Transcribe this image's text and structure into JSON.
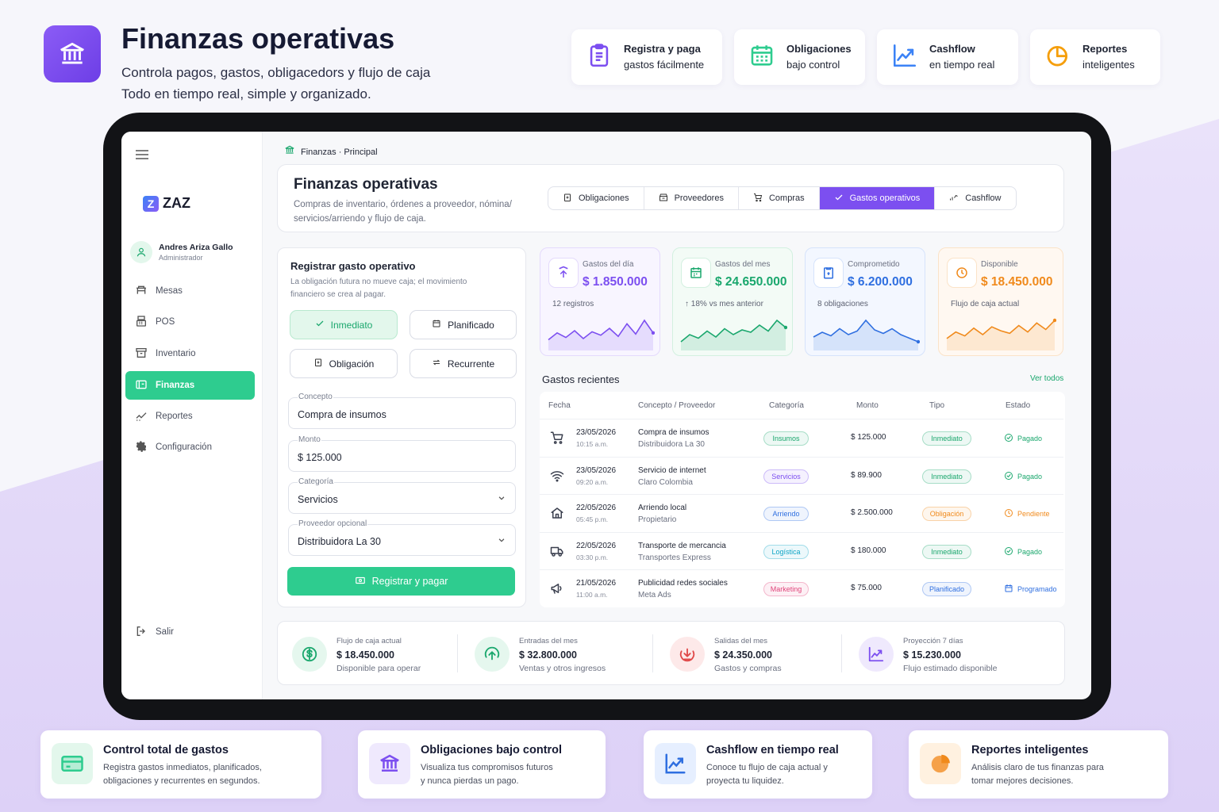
{
  "hero": {
    "title": "Finanzas operativas",
    "subtitle_line1": "Controla pagos, gastos, obligacedors y flujo de caja",
    "subtitle_line2": "Todo en tiempo real, simple y organizado.",
    "logo_icon": "bank-icon",
    "features": [
      {
        "line1": "Registra y paga",
        "line2": "gastos fácilmente",
        "icon": "clipboard-icon",
        "color": "#7c4ff0"
      },
      {
        "line1": "Obligaciones",
        "line2": "bajo control",
        "icon": "calendar-icon",
        "color": "#2ecc8f"
      },
      {
        "line1": "Cashflow",
        "line2": "en tiempo real",
        "icon": "trend-chart-icon",
        "color": "#3b82f6"
      },
      {
        "line1": "Reportes",
        "line2": "inteligentes",
        "icon": "pie-chart-icon",
        "color": "#f59e0b"
      }
    ]
  },
  "app": {
    "brand": "ZAZ",
    "user": {
      "name": "Andres Ariza Gallo",
      "role": "Administrador"
    },
    "nav": [
      {
        "label": "Mesas",
        "icon": "table-icon"
      },
      {
        "label": "POS",
        "icon": "register-icon"
      },
      {
        "label": "Inventario",
        "icon": "box-icon"
      },
      {
        "label": "Finanzas",
        "icon": "wallet-icon",
        "active": true
      },
      {
        "label": "Reportes",
        "icon": "trend-icon"
      },
      {
        "label": "Configuración",
        "icon": "gear-icon"
      }
    ],
    "logout": "Salir",
    "breadcrumb": "Finanzas · Principal",
    "page_title": "Finanzas operativas",
    "page_desc_line1": "Compras de inventario, órdenes a proveedor, nómina/",
    "page_desc_line2": "servicios/arriendo y flujo de caja.",
    "tabs": [
      {
        "label": "Obligaciones",
        "icon": "clipboard-icon"
      },
      {
        "label": "Proveedores",
        "icon": "store-icon"
      },
      {
        "label": "Compras",
        "icon": "cart-icon"
      },
      {
        "label": "Gastos operativos",
        "icon": "check-icon",
        "active": true
      },
      {
        "label": "Cashflow",
        "icon": "cashflow-icon"
      }
    ]
  },
  "form": {
    "title": "Registrar gasto operativo",
    "desc_line1": "La obligación futura no mueve caja; el movimiento",
    "desc_line2": "financiero se crea al pagar.",
    "options": [
      "Inmediato",
      "Planificado",
      "Obligación",
      "Recurrente"
    ],
    "selected_option": "Inmediato",
    "concepto_label": "Concepto",
    "concepto_value": "Compra de insumos",
    "monto_label": "Monto",
    "monto_value": "$ 125.000",
    "categoria_label": "Categoría",
    "categoria_value": "Servicios",
    "proveedor_label": "Proveedor opcional",
    "proveedor_value": "Distribuidora La 30",
    "submit": "Registrar y pagar"
  },
  "kpis": [
    {
      "label": "Gastos del día",
      "value": "$ 1.850.000",
      "sub": "12 registros",
      "color": "#7c4ff0",
      "bg": "#f8f5ff",
      "border": "#e4dafc",
      "icon": "upload-icon",
      "spark": [
        8,
        14,
        10,
        16,
        9,
        15,
        12,
        18,
        11,
        22,
        13,
        25,
        14
      ]
    },
    {
      "label": "Gastos del mes",
      "value": "$ 24.650.000",
      "sub": "↑ 18% vs mes anterior",
      "color": "#1aa76d",
      "bg": "#f3fbf6",
      "border": "#d3f0e0",
      "icon": "calendar-icon",
      "spark": [
        6,
        12,
        9,
        15,
        10,
        17,
        12,
        16,
        14,
        20,
        15,
        24,
        18
      ]
    },
    {
      "label": "Comprometido",
      "value": "$ 6.200.000",
      "sub": "8 obligaciones",
      "color": "#2f6fe0",
      "bg": "#f3f7ff",
      "border": "#d6e3fb",
      "icon": "document-icon",
      "spark": [
        10,
        14,
        11,
        17,
        12,
        15,
        24,
        16,
        13,
        17,
        12,
        9,
        6
      ]
    },
    {
      "label": "Disponible",
      "value": "$ 18.450.000",
      "sub": "Flujo de caja actual",
      "color": "#f08a1c",
      "bg": "#fff8f1",
      "border": "#fbe3c8",
      "icon": "clock-icon",
      "spark": [
        8,
        13,
        10,
        16,
        11,
        17,
        14,
        12,
        18,
        13,
        20,
        15,
        22
      ]
    }
  ],
  "recent": {
    "title": "Gastos recientes",
    "see_all": "Ver todos",
    "headers": [
      "Fecha",
      "Concepto / Proveedor",
      "Categoría",
      "Monto",
      "Tipo",
      "Estado"
    ],
    "rows": [
      {
        "icon": "cart-icon",
        "date": "23/05/2026",
        "time": "10:15 a.m.",
        "concept": "Compra de insumos",
        "provider": "Distribuidora La 30",
        "category": "Insumos",
        "cat_color": "#1aa76d",
        "amount": "$ 125.000",
        "type": "Inmediato",
        "type_color": "#1aa76d",
        "status": "Pagado",
        "status_color": "#1aa76d",
        "status_icon": "check-circle-icon"
      },
      {
        "icon": "wifi-icon",
        "date": "23/05/2026",
        "time": "09:20 a.m.",
        "concept": "Servicio de internet",
        "provider": "Claro Colombia",
        "category": "Servicios",
        "cat_color": "#7c4ff0",
        "amount": "$ 89.900",
        "type": "Inmediato",
        "type_color": "#1aa76d",
        "status": "Pagado",
        "status_color": "#1aa76d",
        "status_icon": "check-circle-icon"
      },
      {
        "icon": "home-icon",
        "date": "22/05/2026",
        "time": "05:45 p.m.",
        "concept": "Arriendo local",
        "provider": "Propietario",
        "category": "Arriendo",
        "cat_color": "#2f6fe0",
        "amount": "$ 2.500.000",
        "type": "Obligación",
        "type_color": "#f08a1c",
        "status": "Pendiente",
        "status_color": "#f08a1c",
        "status_icon": "clock-icon"
      },
      {
        "icon": "truck-icon",
        "date": "22/05/2026",
        "time": "03:30 p.m.",
        "concept": "Transporte de mercancia",
        "provider": "Transportes Express",
        "category": "Logística",
        "cat_color": "#0ea5c6",
        "amount": "$ 180.000",
        "type": "Inmediato",
        "type_color": "#1aa76d",
        "status": "Pagado",
        "status_color": "#1aa76d",
        "status_icon": "check-circle-icon"
      },
      {
        "icon": "megaphone-icon",
        "date": "21/05/2026",
        "time": "11:00 a.m.",
        "concept": "Publicidad redes sociales",
        "provider": "Meta Ads",
        "category": "Marketing",
        "cat_color": "#e0457b",
        "amount": "$ 75.000",
        "type": "Planificado",
        "type_color": "#2f6fe0",
        "status": "Programado",
        "status_color": "#2f6fe0",
        "status_icon": "calendar-icon"
      }
    ]
  },
  "cashflow": [
    {
      "label": "Flujo de caja actual",
      "value": "$ 18.450.000",
      "sub": "Disponible para operar",
      "icon": "dollar-icon",
      "color": "#1aa76d",
      "bg": "#e5f7ee"
    },
    {
      "label": "Entradas del mes",
      "value": "$ 32.800.000",
      "sub": "Ventas y otros ingresos",
      "icon": "arrow-up-circle-icon",
      "color": "#1aa76d",
      "bg": "#e5f7ee"
    },
    {
      "label": "Salidas del mes",
      "value": "$ 24.350.000",
      "sub": "Gastos y compras",
      "icon": "arrow-down-circle-icon",
      "color": "#e04848",
      "bg": "#fde9e9"
    },
    {
      "label": "Proyección 7 días",
      "value": "$ 15.230.000",
      "sub": "Flujo estimado disponible",
      "icon": "trend-chart-icon",
      "color": "#7c4ff0",
      "bg": "#efe9fd"
    }
  ],
  "bottom_features": [
    {
      "title": "Control total de gastos",
      "line1": "Registra gastos inmediatos, planificados,",
      "line2": "obligaciones y recurrentes en segundos.",
      "icon": "card-icon",
      "color": "#2ecc8f",
      "bg": "#e3f7ec"
    },
    {
      "title": "Obligaciones bajo control",
      "line1": "Visualiza tus compromisos futuros",
      "line2": "y nunca pierdas un pago.",
      "icon": "bank-icon",
      "color": "#7c4ff0",
      "bg": "#efe9fd"
    },
    {
      "title": "Cashflow en tiempo real",
      "line1": "Conoce tu flujo de caja actual y",
      "line2": "proyecta tu liquidez.",
      "icon": "trend-chart-icon",
      "color": "#2f6fe0",
      "bg": "#e6efff"
    },
    {
      "title": "Reportes inteligentes",
      "line1": "Análisis claro de tus finanzas para",
      "line2": "tomar mejores decisiones.",
      "icon": "pie-chart-icon",
      "color": "#f08a1c",
      "bg": "#fff1e0"
    }
  ]
}
